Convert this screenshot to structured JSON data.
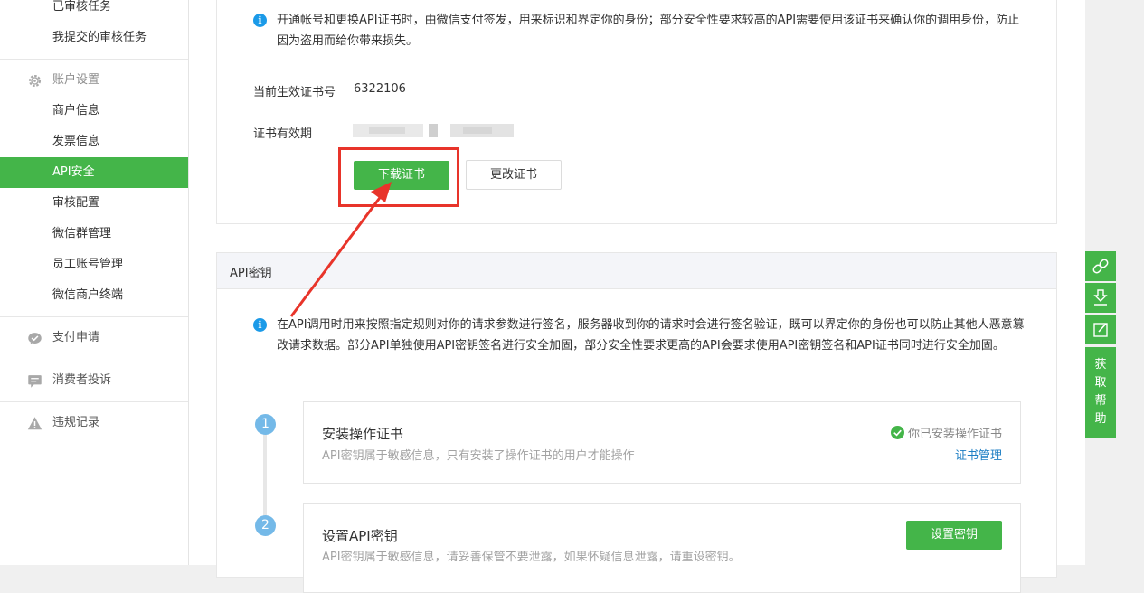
{
  "sidebar": {
    "top_items": [
      {
        "label": "已审核任务"
      },
      {
        "label": "我提交的审核任务"
      }
    ],
    "account_group": {
      "label": "账户设置",
      "icon": "gear-icon"
    },
    "account_items": [
      {
        "label": "商户信息"
      },
      {
        "label": "发票信息"
      },
      {
        "label": "API安全",
        "active": true
      },
      {
        "label": "审核配置"
      },
      {
        "label": "微信群管理"
      },
      {
        "label": "员工账号管理"
      },
      {
        "label": "微信商户终端"
      }
    ],
    "pay_apply": {
      "label": "支付申请",
      "icon": "chat-check-icon"
    },
    "complaint": {
      "label": "消费者投诉",
      "icon": "comment-icon"
    },
    "violation": {
      "label": "违规记录",
      "icon": "warning-icon"
    }
  },
  "cert_section": {
    "notice": "开通帐号和更换API证书时，由微信支付签发，用来标识和界定你的身份；部分安全性要求较高的API需要使用该证书来确认你的调用身份，防止因为盗用而给你带来损失。",
    "cert_no_label": "当前生效证书号",
    "cert_no_value": "6322106",
    "validity_label": "证书有效期",
    "download_button": "下载证书",
    "change_button": "更改证书"
  },
  "api_key_section": {
    "title": "API密钥",
    "notice": "在API调用时用来按照指定规则对你的请求参数进行签名，服务器收到你的请求时会进行签名验证，既可以界定你的身份也可以防止其他人恶意篡改请求数据。部分API单独使用API密钥签名进行安全加固，部分安全性要求更高的API会要求使用API密钥签名和API证书同时进行安全加固。",
    "steps": [
      {
        "number": "1",
        "title": "安装操作证书",
        "desc": "API密钥属于敏感信息，只有安装了操作证书的用户才能操作",
        "status": "你已安装操作证书",
        "link": "证书管理"
      },
      {
        "number": "2",
        "title": "设置API密钥",
        "desc": "API密钥属于敏感信息，请妥善保管不要泄露，如果怀疑信息泄露，请重设密钥。",
        "button": "设置密钥"
      }
    ]
  },
  "float_toolbar": {
    "help_chars": [
      "获",
      "取",
      "帮",
      "助"
    ]
  },
  "colors": {
    "brand_green": "#44b549",
    "info_blue": "#1b9ae8",
    "annotation_red": "#e8342a",
    "link_blue": "#1f7fc4"
  }
}
